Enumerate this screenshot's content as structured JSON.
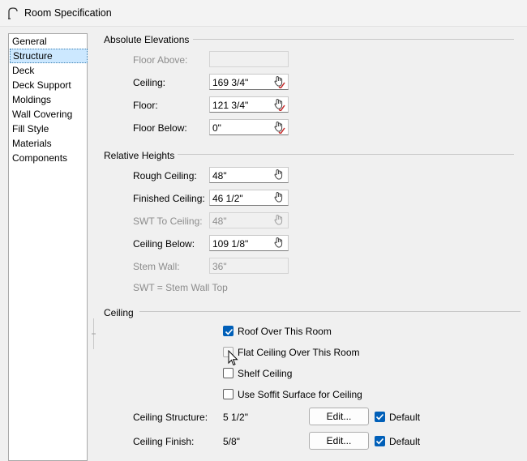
{
  "window": {
    "title": "Room Specification"
  },
  "nav": {
    "items": [
      "General",
      "Structure",
      "Deck",
      "Deck Support",
      "Moldings",
      "Wall Covering",
      "Fill Style",
      "Materials",
      "Components"
    ],
    "selected": "Structure"
  },
  "abs": {
    "title": "Absolute Elevations",
    "floor_above": {
      "label": "Floor Above:",
      "value": ""
    },
    "ceiling": {
      "label": "Ceiling:",
      "value": "169 3/4\""
    },
    "floor": {
      "label": "Floor:",
      "value": "121 3/4\""
    },
    "floor_below": {
      "label": "Floor Below:",
      "value": "0\""
    }
  },
  "rel": {
    "title": "Relative Heights",
    "rough": {
      "label": "Rough Ceiling:",
      "value": "48\""
    },
    "finished": {
      "label": "Finished Ceiling:",
      "value": "46 1/2\""
    },
    "swt": {
      "label": "SWT To Ceiling:",
      "value": "48\""
    },
    "below": {
      "label": "Ceiling Below:",
      "value": "109 1/8\""
    },
    "stem": {
      "label": "Stem Wall:",
      "value": "36\""
    },
    "note": "SWT = Stem Wall Top"
  },
  "ceil": {
    "title": "Ceiling",
    "roof_over": {
      "label": "Roof Over This Room",
      "checked": true
    },
    "flat": {
      "label": "Flat Ceiling Over This Room",
      "checked": false
    },
    "shelf": {
      "label": "Shelf Ceiling",
      "checked": false
    },
    "soffit": {
      "label": "Use Soffit Surface for Ceiling",
      "checked": false
    },
    "structure": {
      "label": "Ceiling Structure:",
      "value": "5 1/2\"",
      "button": "Edit...",
      "default_label": "Default",
      "default_checked": true
    },
    "finish": {
      "label": "Ceiling Finish:",
      "value": "5/8\"",
      "button": "Edit...",
      "default_label": "Default",
      "default_checked": true
    }
  },
  "colors": {
    "accent": "#005fb8",
    "selection": "#cce8ff",
    "disabled_text": "#8c8c8c"
  }
}
